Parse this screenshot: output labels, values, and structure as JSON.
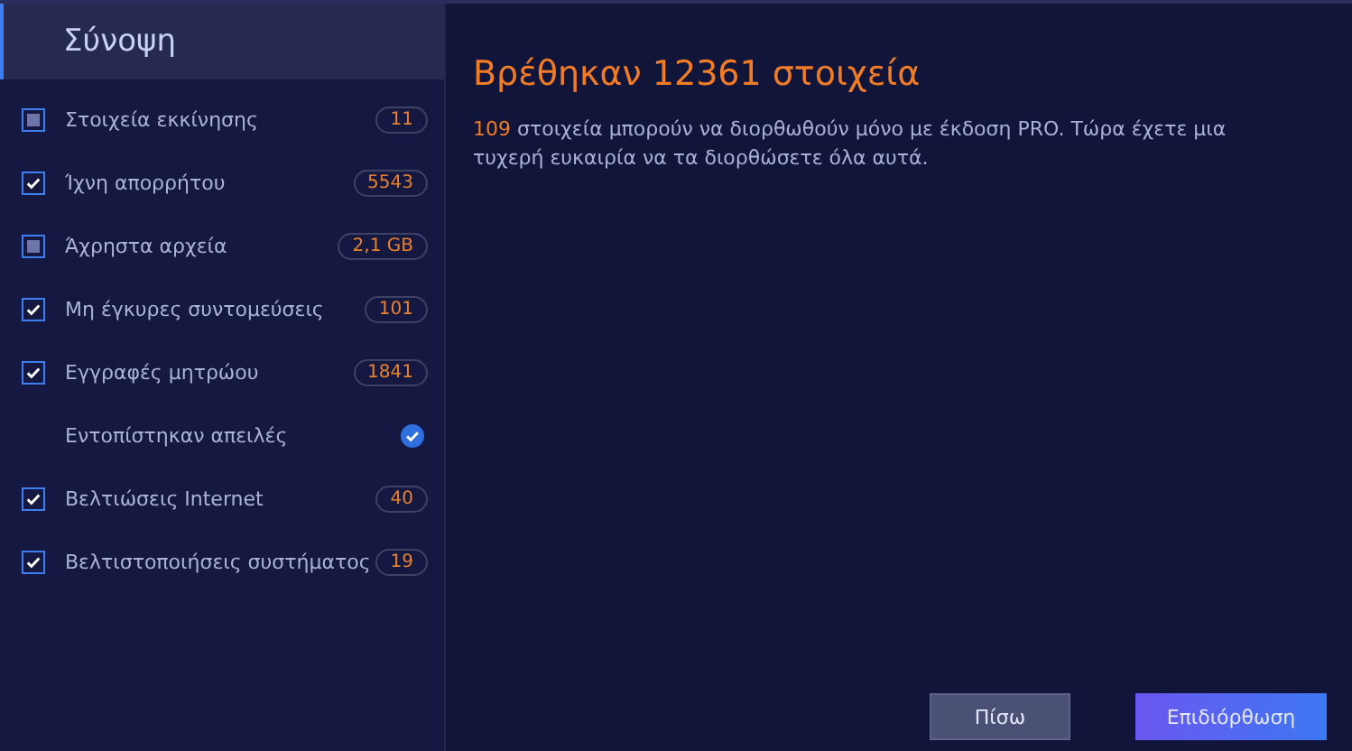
{
  "sidebar": {
    "title": "Σύνοψη",
    "items": [
      {
        "kind": "checkbox",
        "label": "Στοιχεία εκκίνησης",
        "checked": false,
        "count": "11"
      },
      {
        "kind": "checkbox",
        "label": "Ίχνη απορρήτου",
        "checked": true,
        "count": "5543"
      },
      {
        "kind": "checkbox",
        "label": "Άχρηστα αρχεία",
        "checked": false,
        "count": "2,1 GB"
      },
      {
        "kind": "checkbox",
        "label": "Μη έγκυρες συντομεύσεις",
        "checked": true,
        "count": "101"
      },
      {
        "kind": "checkbox",
        "label": "Εγγραφές μητρώου",
        "checked": true,
        "count": "1841"
      },
      {
        "kind": "status",
        "label": "Εντοπίστηκαν απειλές"
      },
      {
        "kind": "checkbox",
        "label": "Βελτιώσεις Internet",
        "checked": true,
        "count": "40"
      },
      {
        "kind": "checkbox",
        "label": "Βελτιστοποιήσεις συστήματος",
        "checked": true,
        "count": "19"
      }
    ]
  },
  "main": {
    "heading": "Βρέθηκαν 12361 στοιχεία",
    "message": "**109** στοιχεία μπορούν να διορθωθούν μόνο με έκδοση PRO. Τώρα έχετε μια τυχερή ευκαιρία να τα διορθώσετε όλα αυτά."
  },
  "buttons": [
    {
      "kind": "secondary",
      "label": "Πίσω"
    },
    {
      "kind": "primary",
      "label": "Επιδιόρθωση"
    }
  ]
}
